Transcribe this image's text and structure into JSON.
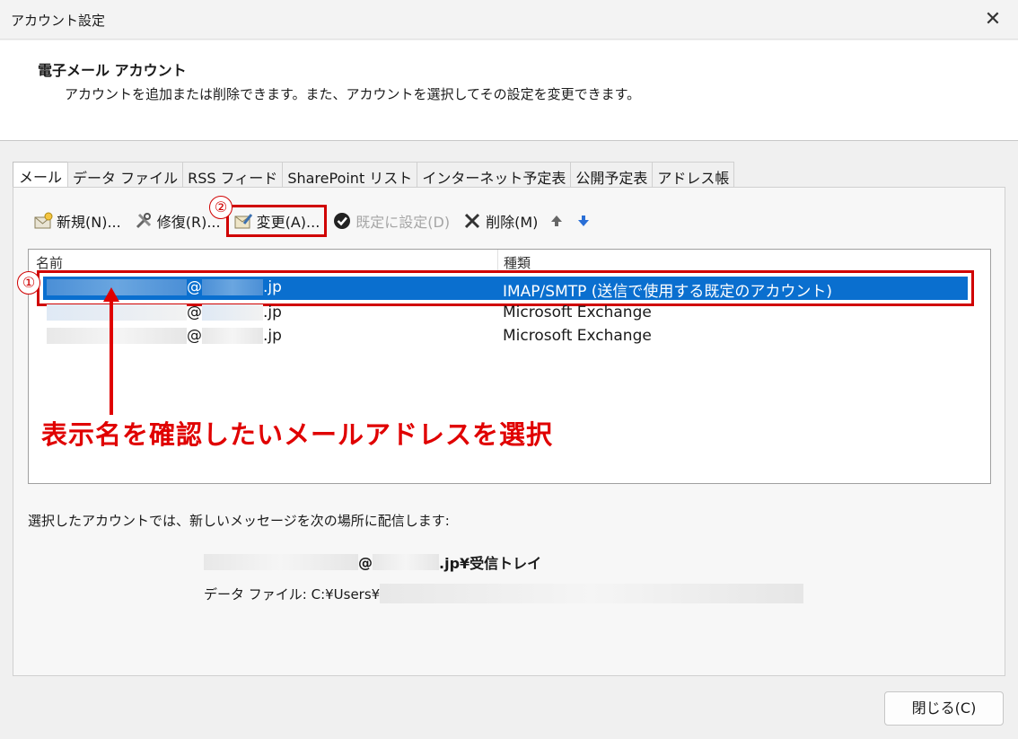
{
  "window": {
    "title": "アカウント設定",
    "close_label": "✕"
  },
  "header": {
    "title": "電子メール アカウント",
    "description": "アカウントを追加または削除できます。また、アカウントを選択してその設定を変更できます。"
  },
  "tabs": [
    {
      "label": "メール"
    },
    {
      "label": "データ ファイル"
    },
    {
      "label": "RSS フィード"
    },
    {
      "label": "SharePoint リスト"
    },
    {
      "label": "インターネット予定表"
    },
    {
      "label": "公開予定表"
    },
    {
      "label": "アドレス帳"
    }
  ],
  "toolbar": {
    "new_label": "新規(N)...",
    "repair_label": "修復(R)...",
    "change_label": "変更(A)...",
    "default_label": "既定に設定(D)",
    "delete_label": "削除(M)"
  },
  "list": {
    "col_name": "名前",
    "col_type": "種類",
    "rows": [
      {
        "at": "@",
        "domain": ".jp",
        "type": "IMAP/SMTP (送信で使用する既定のアカウント)"
      },
      {
        "at": "@",
        "domain": ".jp",
        "type": "Microsoft Exchange"
      },
      {
        "at": "@",
        "domain": ".jp",
        "type": "Microsoft Exchange"
      }
    ]
  },
  "annotations": {
    "badge1": "①",
    "badge2": "②",
    "callout": "表示名を確認したいメールアドレスを選択"
  },
  "delivery": {
    "label": "選択したアカウントでは、新しいメッセージを次の場所に配信します:",
    "at": "@",
    "folder": ".jp¥受信トレイ",
    "datafile_prefix": "データ ファイル: C:¥Users¥"
  },
  "footer": {
    "close_button": "閉じる(C)"
  },
  "colors": {
    "accent": "#0a6fcf",
    "annotation_red": "#e00000"
  }
}
